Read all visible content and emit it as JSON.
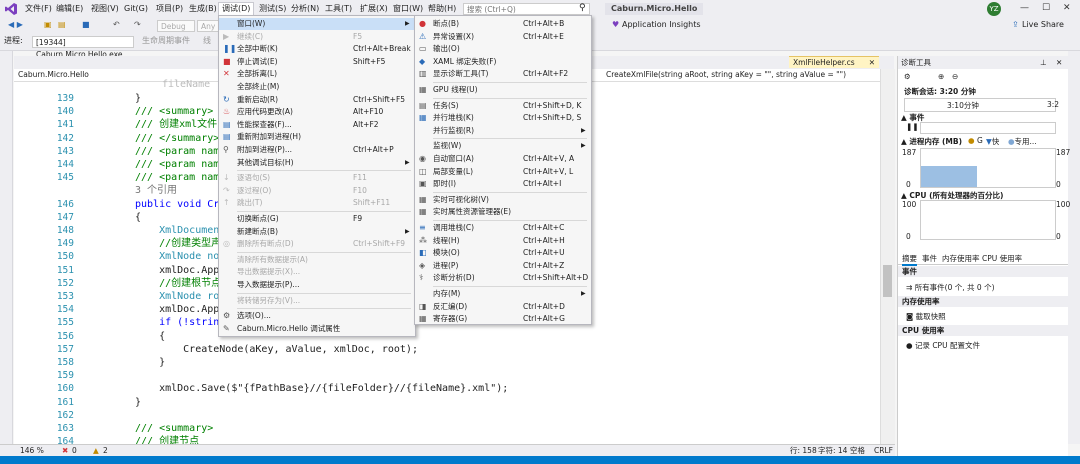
{
  "menubar": {
    "items": [
      "文件(F)",
      "编辑(E)",
      "视图(V)",
      "Git(G)",
      "项目(P)",
      "生成(B)",
      "调试(D)",
      "测试(S)",
      "分析(N)",
      "工具(T)",
      "扩展(X)",
      "窗口(W)",
      "帮助(H)"
    ],
    "search_placeholder": "搜索 (Ctrl+Q)",
    "project_name": "Caburn.Micro.Hello",
    "avatar_initials": "YZ"
  },
  "toolbar": {
    "config": "Debug",
    "platform": "Any C",
    "insights": "Application Insights",
    "live_share": "Live Share",
    "process_label": "进程:",
    "process_value": "[19344] Caburn.Micro.Hello.exe",
    "lifecycle_label": "生命周期事件",
    "thread": "线"
  },
  "editor": {
    "tab_label": "XmlFileHelper.cs",
    "nav_left": "Caburn.Micro.Hello",
    "nav_right": "CreateXmlFile(string aRoot, string aKey = \"\", string aValue = \"\")",
    "lines": [
      {
        "n": "139",
        "t": "}",
        "c": ""
      },
      {
        "n": "140",
        "t": "/// <summary>",
        "c": "cmt"
      },
      {
        "n": "141",
        "t": "/// 创建xml文件",
        "c": "cmt"
      },
      {
        "n": "142",
        "t": "/// </summary>",
        "c": "cmt"
      },
      {
        "n": "143",
        "t": "/// <param name",
        "c": "cmt"
      },
      {
        "n": "144",
        "t": "/// <param name",
        "c": "cmt"
      },
      {
        "n": "145",
        "t": "/// <param name",
        "c": "cmt"
      },
      {
        "n": "",
        "t": "3 个引用",
        "c": "gray"
      },
      {
        "n": "146",
        "t": "public void Cre",
        "c": "kw"
      },
      {
        "n": "147",
        "t": "{",
        "c": ""
      },
      {
        "n": "148",
        "t": "    XmlDocument",
        "c": "ty"
      },
      {
        "n": "149",
        "t": "    //创建类型声",
        "c": "cmt"
      },
      {
        "n": "150",
        "t": "    XmlNode nod",
        "c": "ty"
      },
      {
        "n": "151",
        "t": "    xmlDoc.Appe",
        "c": ""
      },
      {
        "n": "152",
        "t": "    //创建根节点",
        "c": "cmt"
      },
      {
        "n": "153",
        "t": "    XmlNode roo",
        "c": "ty"
      },
      {
        "n": "154",
        "t": "    xmlDoc.Appe",
        "c": ""
      },
      {
        "n": "155",
        "t": "    if (!string",
        "c": "kw"
      },
      {
        "n": "156",
        "t": "    {",
        "c": ""
      },
      {
        "n": "157",
        "t": "        CreateNode(aKey, aValue, xmlDoc, root);",
        "c": ""
      },
      {
        "n": "158",
        "t": "    }",
        "c": ""
      },
      {
        "n": "159",
        "t": "",
        "c": ""
      },
      {
        "n": "160",
        "t": "    xmlDoc.Save($\"{fPathBase}//{fileFolder}//{fileName}.xml\");",
        "c": ""
      },
      {
        "n": "161",
        "t": "}",
        "c": ""
      },
      {
        "n": "162",
        "t": "",
        "c": ""
      },
      {
        "n": "163",
        "t": "/// <summary>",
        "c": "cmt"
      },
      {
        "n": "164",
        "t": "/// 创建节点",
        "c": "cmt"
      }
    ],
    "first_line_fragment": "fileName"
  },
  "statusbar": {
    "zoom": "146 %",
    "errors": "0",
    "warnings": "2",
    "position": "行: 158",
    "col": "字符: 14",
    "mode1": "空格",
    "mode2": "CRLF"
  },
  "debug_menu": {
    "items": [
      {
        "label": "窗口(W)",
        "shortcut": "",
        "arrow": true,
        "state": "hl",
        "sepAfter": false,
        "icon": ""
      },
      {
        "label": "继续(C)",
        "shortcut": "F5",
        "arrow": false,
        "state": "dis",
        "sepAfter": false,
        "icon": "play"
      },
      {
        "label": "全部中断(K)",
        "shortcut": "Ctrl+Alt+Break",
        "arrow": false,
        "state": "",
        "sepAfter": false,
        "icon": "pause"
      },
      {
        "label": "停止调试(E)",
        "shortcut": "Shift+F5",
        "arrow": false,
        "state": "",
        "sepAfter": false,
        "icon": "stop"
      },
      {
        "label": "全部拆离(L)",
        "shortcut": "",
        "arrow": false,
        "state": "",
        "sepAfter": false,
        "icon": "x"
      },
      {
        "label": "全部终止(M)",
        "shortcut": "",
        "arrow": false,
        "state": "",
        "sepAfter": false,
        "icon": ""
      },
      {
        "label": "重新启动(R)",
        "shortcut": "Ctrl+Shift+F5",
        "arrow": false,
        "state": "",
        "sepAfter": false,
        "icon": "restart"
      },
      {
        "label": "应用代码更改(A)",
        "shortcut": "Alt+F10",
        "arrow": false,
        "state": "",
        "sepAfter": false,
        "icon": "fire"
      },
      {
        "label": "性能探查器(F)...",
        "shortcut": "Alt+F2",
        "arrow": false,
        "state": "",
        "sepAfter": false,
        "icon": "perf"
      },
      {
        "label": "重新附加到进程(H)",
        "shortcut": "",
        "arrow": false,
        "state": "",
        "sepAfter": false,
        "icon": "perf"
      },
      {
        "label": "附加到进程(P)...",
        "shortcut": "Ctrl+Alt+P",
        "arrow": false,
        "state": "",
        "sepAfter": false,
        "icon": "attach"
      },
      {
        "label": "其他调试目标(H)",
        "shortcut": "",
        "arrow": true,
        "state": "",
        "sepAfter": true,
        "icon": ""
      },
      {
        "label": "逐语句(S)",
        "shortcut": "F11",
        "arrow": false,
        "state": "dis",
        "sepAfter": false,
        "icon": "stepin"
      },
      {
        "label": "逐过程(O)",
        "shortcut": "F10",
        "arrow": false,
        "state": "dis",
        "sepAfter": false,
        "icon": "stepover"
      },
      {
        "label": "跳出(T)",
        "shortcut": "Shift+F11",
        "arrow": false,
        "state": "dis",
        "sepAfter": true,
        "icon": "stepout"
      },
      {
        "label": "切换断点(G)",
        "shortcut": "F9",
        "arrow": false,
        "state": "",
        "sepAfter": false,
        "icon": ""
      },
      {
        "label": "新建断点(B)",
        "shortcut": "",
        "arrow": true,
        "state": "",
        "sepAfter": false,
        "icon": ""
      },
      {
        "label": "删除所有断点(D)",
        "shortcut": "Ctrl+Shift+F9",
        "arrow": false,
        "state": "dis",
        "sepAfter": true,
        "icon": "delbp"
      },
      {
        "label": "清除所有数据提示(A)",
        "shortcut": "",
        "arrow": false,
        "state": "dis",
        "sepAfter": false,
        "icon": ""
      },
      {
        "label": "导出数据提示(X)...",
        "shortcut": "",
        "arrow": false,
        "state": "dis",
        "sepAfter": false,
        "icon": ""
      },
      {
        "label": "导入数据提示(P)...",
        "shortcut": "",
        "arrow": false,
        "state": "",
        "sepAfter": true,
        "icon": ""
      },
      {
        "label": "将转储另存为(V)...",
        "shortcut": "",
        "arrow": false,
        "state": "dis",
        "sepAfter": true,
        "icon": ""
      },
      {
        "label": "选项(O)...",
        "shortcut": "",
        "arrow": false,
        "state": "",
        "sepAfter": false,
        "icon": "gear"
      },
      {
        "label": "Caburn.Micro.Hello 调试属性",
        "shortcut": "",
        "arrow": false,
        "state": "",
        "sepAfter": false,
        "icon": "wrench"
      }
    ]
  },
  "window_submenu": {
    "items": [
      {
        "label": "断点(B)",
        "shortcut": "Ctrl+Alt+B",
        "arrow": false,
        "sepAfter": false,
        "icon": "bp"
      },
      {
        "label": "异常设置(X)",
        "shortcut": "Ctrl+Alt+E",
        "arrow": false,
        "sepAfter": false,
        "icon": "exc"
      },
      {
        "label": "输出(O)",
        "shortcut": "",
        "arrow": false,
        "sepAfter": false,
        "icon": "out"
      },
      {
        "label": "XAML 绑定失败(F)",
        "shortcut": "",
        "arrow": false,
        "sepAfter": false,
        "icon": "xaml"
      },
      {
        "label": "显示诊断工具(T)",
        "shortcut": "Ctrl+Alt+F2",
        "arrow": false,
        "sepAfter": true,
        "icon": "diag"
      },
      {
        "label": "GPU 线程(U)",
        "shortcut": "",
        "arrow": false,
        "sepAfter": true,
        "icon": "gpu"
      },
      {
        "label": "任务(S)",
        "shortcut": "Ctrl+Shift+D, K",
        "arrow": false,
        "sepAfter": false,
        "icon": "task"
      },
      {
        "label": "并行堆栈(K)",
        "shortcut": "Ctrl+Shift+D, S",
        "arrow": false,
        "sepAfter": false,
        "icon": "pstack"
      },
      {
        "label": "并行监视(R)",
        "shortcut": "",
        "arrow": true,
        "sepAfter": true,
        "icon": ""
      },
      {
        "label": "监视(W)",
        "shortcut": "",
        "arrow": true,
        "sepAfter": false,
        "icon": ""
      },
      {
        "label": "自动窗口(A)",
        "shortcut": "Ctrl+Alt+V, A",
        "arrow": false,
        "sepAfter": false,
        "icon": "auto"
      },
      {
        "label": "局部变量(L)",
        "shortcut": "Ctrl+Alt+V, L",
        "arrow": false,
        "sepAfter": false,
        "icon": "locals"
      },
      {
        "label": "即时(I)",
        "shortcut": "Ctrl+Alt+I",
        "arrow": false,
        "sepAfter": true,
        "icon": "imm"
      },
      {
        "label": "实时可视化树(V)",
        "shortcut": "",
        "arrow": false,
        "sepAfter": false,
        "icon": "tree"
      },
      {
        "label": "实时属性资源管理器(E)",
        "shortcut": "",
        "arrow": false,
        "sepAfter": true,
        "icon": "tree"
      },
      {
        "label": "调用堆栈(C)",
        "shortcut": "Ctrl+Alt+C",
        "arrow": false,
        "sepAfter": false,
        "icon": "call"
      },
      {
        "label": "线程(H)",
        "shortcut": "Ctrl+Alt+H",
        "arrow": false,
        "sepAfter": false,
        "icon": "thread"
      },
      {
        "label": "模块(O)",
        "shortcut": "Ctrl+Alt+U",
        "arrow": false,
        "sepAfter": false,
        "icon": "mod"
      },
      {
        "label": "进程(P)",
        "shortcut": "Ctrl+Alt+Z",
        "arrow": false,
        "sepAfter": false,
        "icon": "proc"
      },
      {
        "label": "诊断分析(D)",
        "shortcut": "Ctrl+Shift+Alt+D",
        "arrow": false,
        "sepAfter": true,
        "icon": "anal"
      },
      {
        "label": "内存(M)",
        "shortcut": "",
        "arrow": true,
        "sepAfter": false,
        "icon": ""
      },
      {
        "label": "反汇编(D)",
        "shortcut": "Ctrl+Alt+D",
        "arrow": false,
        "sepAfter": false,
        "icon": "dis"
      },
      {
        "label": "寄存器(G)",
        "shortcut": "Ctrl+Alt+G",
        "arrow": false,
        "sepAfter": false,
        "icon": "reg"
      }
    ]
  },
  "diagnostics": {
    "title": "诊断工具",
    "session_label": "诊断会话: 3:20 分钟",
    "timeline_label": "3:10分钟",
    "timeline_end": "3:2",
    "events_header": "▲ 事件",
    "memory_header": "▲ 进程内存 (MB)",
    "memory_legend_g": "G",
    "memory_legend_fast": "快",
    "memory_legend_snap": "专用...",
    "mem_max_left": "187",
    "mem_max_right": "187",
    "mem_min_left": "0",
    "mem_min_right": "0",
    "cpu_header": "▲ CPU (所有处理器的百分比)",
    "cpu_max_left": "100",
    "cpu_max_right": "100",
    "cpu_min_left": "0",
    "cpu_min_right": "0",
    "tabs": [
      "摘要",
      "事件",
      "内存使用率",
      "CPU 使用率"
    ],
    "section_events": "事件",
    "all_events": "所有事件(0 个, 共 0 个)",
    "section_memory": "内存使用率",
    "snapshot": "截取快照",
    "section_cpu": "CPU 使用率",
    "cpu_profile": "记录 CPU 配置文件"
  }
}
